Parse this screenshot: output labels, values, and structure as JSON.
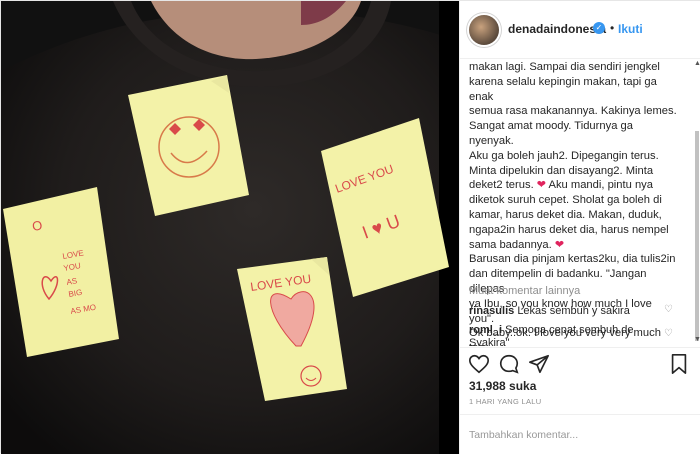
{
  "header": {
    "username": "denadaindonesia",
    "follow_label": "Ikuti",
    "separator": "•"
  },
  "caption": {
    "line1": "makan lagi. Sampai dia sendiri jengkel",
    "line2": "karena selalu kepingin makan, tapi ga enak",
    "line3": "semua rasa makanannya. Kakinya lemes.",
    "line4": "Sangat amat moody. Tidurnya ga nyenyak.",
    "line5": "Aku ga boleh jauh2. Dipegangin terus.",
    "line6": "Minta dipelukin dan disayang2. Minta",
    "line7": "deket2 terus.",
    "line7b": " Aku mandi, pintu nya",
    "line8": "diketok suruh cepet. Sholat ga boleh di",
    "line9": "kamar, harus deket dia. Makan, duduk,",
    "line10": "ngapa2in harus deket dia, harus nempel",
    "line11": "sama badannya.",
    "line12": "Barusan dia pinjam kertas2ku, dia tulis2in",
    "line13": "dan ditempelin di badanku. \"Jangan dilepas",
    "line14": "ya Ibu, so you know how much I love you\".",
    "line15": "Ok baby..ok. I love you very very much too.",
    "heart": "❤"
  },
  "load_more": "Muat komentar lainnya",
  "comments": [
    {
      "user": "rinasulis",
      "text": "Lekas sembuh y sakira"
    },
    {
      "user": "roml_i",
      "text": "Semoga cepat sembuh de",
      "text2": "Syakira\""
    }
  ],
  "likes": "31,988 suka",
  "time": "1 HARI YANG LALU",
  "add_comment_placeholder": "Tambahkan komentar...",
  "photo_notes": {
    "note1": "LOVE YOU AS BIG AS MOON",
    "note3": "LOVE YOU",
    "note4": "LOVE YOU I ♥ U"
  },
  "icons": {
    "verified": "check-badge-icon",
    "like": "heart-outline-icon",
    "comment": "speech-bubble-icon",
    "share": "paper-plane-icon",
    "save": "bookmark-icon"
  },
  "colors": {
    "accent": "#3897f0",
    "heart": "#e0245e",
    "note": "#f3f2a8"
  }
}
